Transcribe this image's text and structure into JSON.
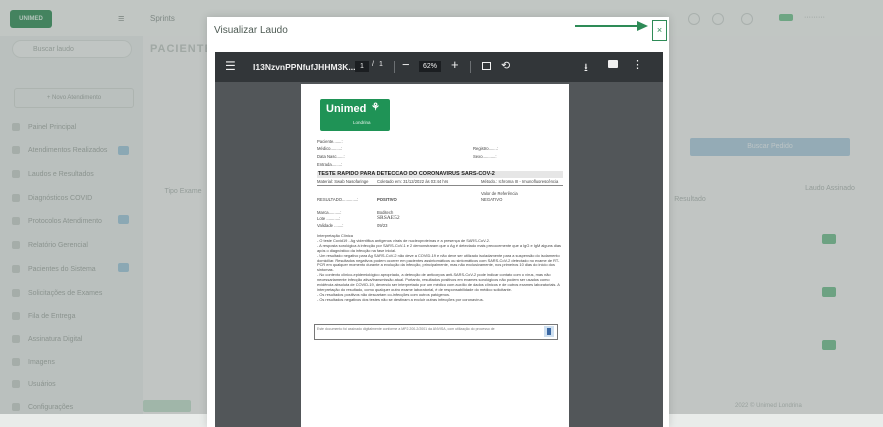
{
  "background": {
    "logo_text": "UNIMED",
    "menu_icon": "hamburger-icon",
    "tenant_label": "Sprints",
    "search_placeholder": "Buscar laudo",
    "new_button": "+ Novo Atendimento",
    "nav_items": [
      "Painel Principal",
      "Atendimentos Realizados",
      "Laudos e Resultados",
      "Diagnósticos COVID",
      "Protocolos Atendimento",
      "Relatório Gerencial",
      "Pacientes do Sistema",
      "Solicitações de Exames",
      "Fila de Entrega",
      "Assinatura Digital",
      "Imagens",
      "Usuários",
      "Configurações"
    ],
    "page_title": "PACIENTE",
    "action_button": "Buscar Pedido",
    "column_headers": [
      "Tipo Exame",
      "Resultado",
      "Laudo Assinado"
    ],
    "footer_text": "2022 © Unimed Londrina"
  },
  "modal": {
    "title": "Visualizar Laudo",
    "close_label": "×",
    "close_icon": "close-icon",
    "annotation_color": "#2e8b57"
  },
  "viewer": {
    "filename": "I13NzvnPPNfufJHHM3K...",
    "current_page": "1",
    "page_separator": "/",
    "total_pages": "1",
    "zoom": "62%",
    "menu_icon": "hamburger-icon",
    "zoom_out_icon": "minus-icon",
    "zoom_in_icon": "plus-icon",
    "fit_icon": "fit-page-icon",
    "rotate_icon": "rotate-icon",
    "download_icon": "download-icon",
    "print_icon": "print-icon",
    "more_icon": "more-vert-icon"
  },
  "report": {
    "logo_name": "Unimed",
    "logo_city": "Londrina",
    "patient_label": "Paciente.......:",
    "doctor_label": "Médico.........:",
    "birth_label": "Data Nasc......:",
    "entry_label": "Entrada........:",
    "registry_label": "Registro.......:",
    "sex_label": "Sexo...........:",
    "test_title": "TESTE RAPIDO PARA DETECCAO DO CORONAVIRUS SARS-COV-2",
    "material": "Material: Swab Nasofaringe",
    "collected": "Coletado em: 31/12/2022 às 03:44 hrs",
    "method": "Método.: Ichroma III - Imunofluorescência",
    "ref_value_header": "Valor de Referência",
    "result_label": "RESULTADO.............:",
    "result_value": "POSITIVO",
    "ref_value": "NEGATIVO",
    "brand_label": "Marca..........:",
    "brand_value": "Boditech",
    "lot_label": "Lote ...........:",
    "lot_value": "SRSAE52",
    "validity_label": "Validade .......:",
    "validity_value": "09/23",
    "interpretation_title": "Interpretação Clínica",
    "interpretation_lines": [
      "- O teste Covid19 - Ag videntifica antígenos virais de nucleoproteínas e a presença de SARS-CoV-2.",
      "- A resposta sorológica à infecção por SARS-CoV-1 e 2 demonstraram que o Ag é detectado mais precocemente que a IgG e IgM alguns dias após o diagnóstico da infecção na fase inicial.",
      "- Um resultado negativo para Ag SARS-CoV-2 não deve a COVID-19 e não deve ser utilizado isoladamente para a suspensão do isolamento domiciliar. Resultados negativos podem ocorrer em pacientes assintomáticos ou sintomáticos com SARS-CoV-2 detectado no exame de RT-PCR em qualquer momento durante a evolução da infecção, principalmente, mas não exclusivamente, nos primeiros 10 dias do início dos sintomas.",
      "- No contexto clínico-epidemiológico apropriado, a detecção de anticorpos anti-SARS-CoV-2 pode indicar contato com o vírus, mas não necessariamente infecção ativa/transmissão atual. Portanto, resultados positivos em exames sorológicos não podem ser usados como evidência absoluta de COVID-19, devendo ser interpretado por um médico com auxílio de dados clínicos e de outros exames laboratoriais. A interpretação do resultado, como qualquer outro exame laboratorial, é de responsabilidade do médico solicitante.",
      "- Os resultados positivos não descartam co-infecções com outros patógenos.",
      "- Os resultados negativos dos testes não se destinam a excluir outras infecções por coronavírus."
    ],
    "footer_text": "Este documento foi assinado digitalmente conforme a MP2.200-2/2001 da ANVISA, com utilização do processo de"
  }
}
